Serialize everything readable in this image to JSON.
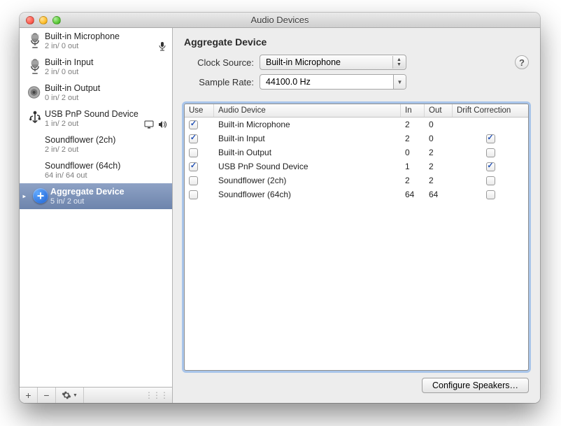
{
  "window": {
    "title": "Audio Devices"
  },
  "sidebar": {
    "items": [
      {
        "name": "Built-in Microphone",
        "io": "2 in/ 0 out",
        "icon": "mic",
        "default_input": true
      },
      {
        "name": "Built-in Input",
        "io": "2 in/ 0 out",
        "icon": "mic"
      },
      {
        "name": "Built-in Output",
        "io": "0 in/ 2 out",
        "icon": "speaker"
      },
      {
        "name": "USB PnP Sound Device",
        "io": "1 in/ 2 out",
        "icon": "usb",
        "default_output": true,
        "system_output": true
      },
      {
        "name": "Soundflower (2ch)",
        "io": "2 in/ 2 out",
        "icon": "none"
      },
      {
        "name": "Soundflower (64ch)",
        "io": "64 in/ 64 out",
        "icon": "none"
      },
      {
        "name": "Aggregate Device",
        "io": "5 in/ 2 out",
        "icon": "plus",
        "selected": true
      }
    ],
    "footer": {
      "add": "+",
      "remove": "−",
      "gear": "✲▾"
    }
  },
  "detail": {
    "heading": "Aggregate Device",
    "clock_label": "Clock Source:",
    "clock_value": "Built-in Microphone",
    "rate_label": "Sample Rate:",
    "rate_value": "44100.0 Hz",
    "help": "?",
    "columns": {
      "use": "Use",
      "name": "Audio Device",
      "in": "In",
      "out": "Out",
      "drift": "Drift Correction"
    },
    "rows": [
      {
        "use": true,
        "name": "Built-in Microphone",
        "in": "2",
        "out": "0",
        "drift": false,
        "drift_enabled": false
      },
      {
        "use": true,
        "name": "Built-in Input",
        "in": "2",
        "out": "0",
        "drift": true,
        "drift_enabled": true
      },
      {
        "use": false,
        "name": "Built-in Output",
        "in": "0",
        "out": "2",
        "drift": false,
        "drift_enabled": true
      },
      {
        "use": true,
        "name": "USB PnP Sound Device",
        "in": "1",
        "out": "2",
        "drift": true,
        "drift_enabled": true
      },
      {
        "use": false,
        "name": "Soundflower (2ch)",
        "in": "2",
        "out": "2",
        "drift": false,
        "drift_enabled": true
      },
      {
        "use": false,
        "name": "Soundflower (64ch)",
        "in": "64",
        "out": "64",
        "drift": false,
        "drift_enabled": true
      }
    ],
    "configure": "Configure Speakers…"
  }
}
